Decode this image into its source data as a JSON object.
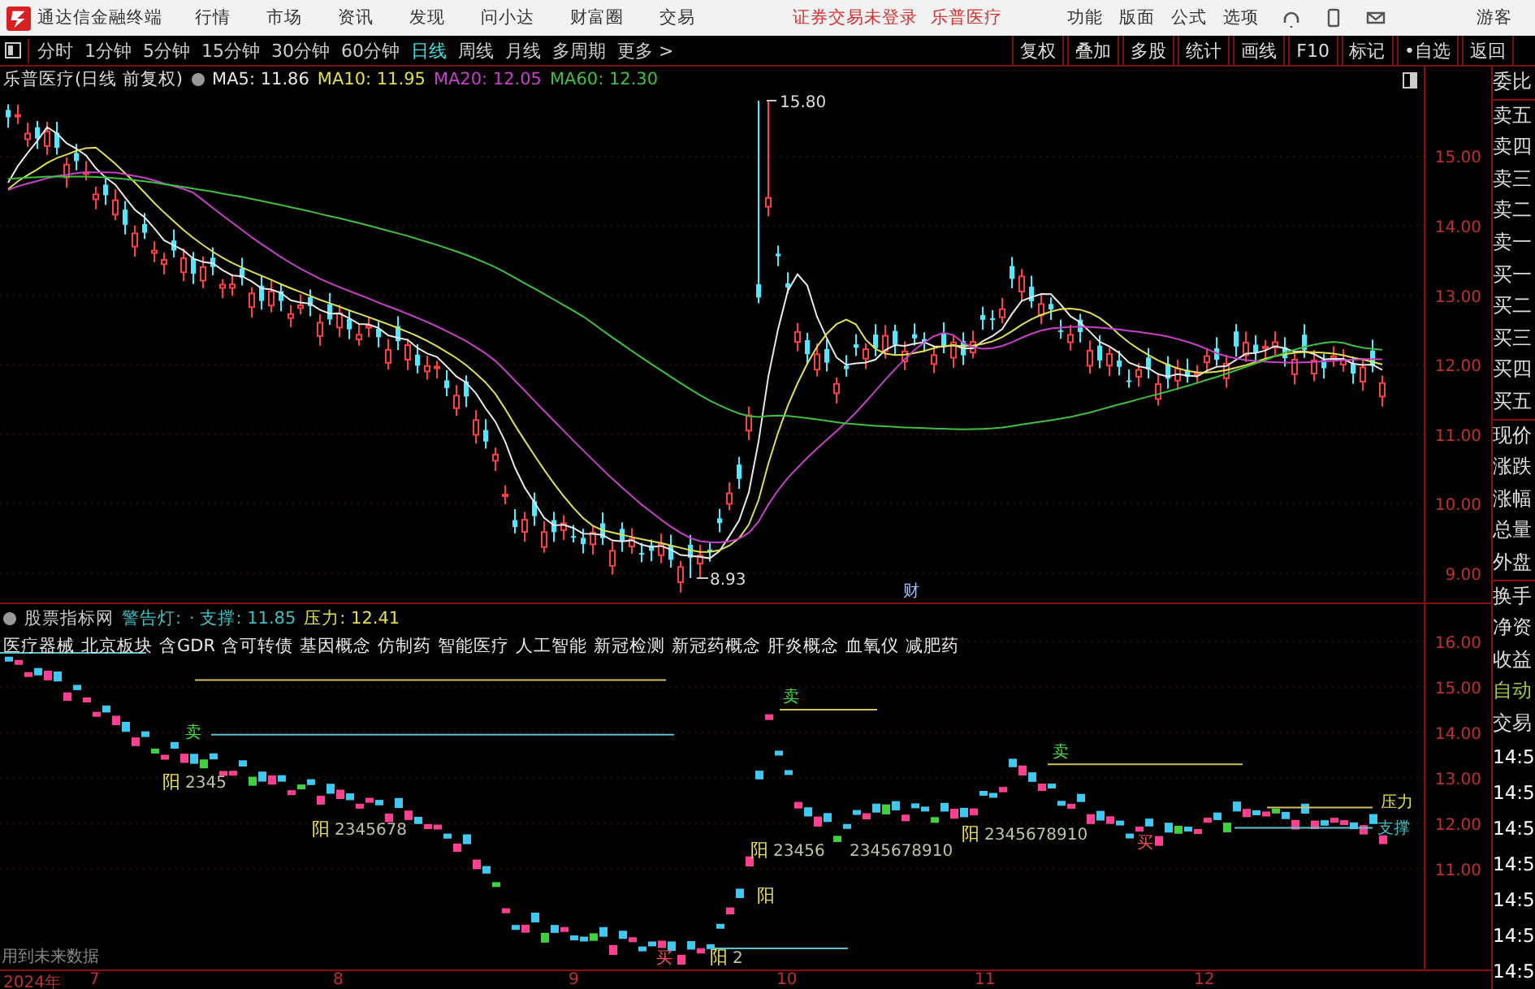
{
  "title_bar": {
    "app_name": "通达信金融终端",
    "menus": [
      "行情",
      "市场",
      "资讯",
      "发现",
      "问小达",
      "财富圈",
      "交易"
    ],
    "login_status": "证券交易未登录",
    "stock_link": "乐普医疗",
    "tools": [
      "功能",
      "版面",
      "公式",
      "选项"
    ],
    "user": "游客"
  },
  "toolbar": {
    "periods": [
      {
        "label": "分时",
        "selected": false
      },
      {
        "label": "1分钟",
        "selected": false
      },
      {
        "label": "5分钟",
        "selected": false
      },
      {
        "label": "15分钟",
        "selected": false
      },
      {
        "label": "30分钟",
        "selected": false
      },
      {
        "label": "60分钟",
        "selected": false
      },
      {
        "label": "日线",
        "selected": true
      },
      {
        "label": "周线",
        "selected": false
      },
      {
        "label": "月线",
        "selected": false
      },
      {
        "label": "多周期",
        "selected": false
      },
      {
        "label": "更多 >",
        "selected": false
      }
    ],
    "buttons": [
      "复权",
      "叠加",
      "多股",
      "统计",
      "画线",
      "F10",
      "标记",
      "•自选",
      "返回"
    ]
  },
  "price_chart": {
    "title": "乐普医疗(日线 前复权)",
    "ma": [
      {
        "label": "MA5: 11.86",
        "color": "#e8e8e8"
      },
      {
        "label": "MA10: 11.95",
        "color": "#e0e050"
      },
      {
        "label": "MA20: 12.05",
        "color": "#c840c8"
      },
      {
        "label": "MA60: 12.30",
        "color": "#40c040"
      }
    ],
    "y_ticks": [
      "15.00",
      "14.00",
      "13.00",
      "12.00",
      "11.00",
      "10.00",
      "9.00"
    ],
    "high_label": "15.80",
    "low_label": "8.93",
    "event_marker": "财"
  },
  "indicator": {
    "source": "股票指标网",
    "name": "警告灯:",
    "support": "· 支撑: 11.85",
    "pressure": "压力: 12.41",
    "concepts": [
      "医疗器械",
      "北京板块",
      "含GDR",
      "含可转债",
      "基因概念",
      "仿制药",
      "智能医疗",
      "人工智能",
      "新冠检测",
      "新冠药概念",
      "肝炎概念",
      "血氧仪",
      "减肥药"
    ],
    "y_ticks": [
      "16.00",
      "15.00",
      "14.00",
      "13.00",
      "12.00",
      "11.00"
    ],
    "signals": [
      {
        "kind": "yang",
        "label": "阳",
        "count": "2345"
      },
      {
        "kind": "yang",
        "label": "阳",
        "count": "2345678"
      },
      {
        "kind": "yang",
        "label": "阳",
        "count": "23456"
      },
      {
        "kind": "count",
        "count": "2345678910"
      },
      {
        "kind": "yang",
        "label": "阳",
        "count": "2345678910"
      },
      {
        "kind": "yang",
        "label": "阳"
      },
      {
        "kind": "yang",
        "label": "阳",
        "count": "2"
      },
      {
        "kind": "sell",
        "label": "卖"
      },
      {
        "kind": "sell",
        "label": "卖"
      },
      {
        "kind": "sell",
        "label": "卖"
      },
      {
        "kind": "buy",
        "label": "买"
      },
      {
        "kind": "buy",
        "label": "买"
      }
    ],
    "pressure_label": "压力",
    "support_label": "支撑",
    "notice": "用到未来数据"
  },
  "date_axis": [
    "2024年",
    "7",
    "8",
    "9",
    "10",
    "11",
    "12"
  ],
  "side_panel": {
    "fields": [
      "委比",
      "卖五",
      "卖四",
      "卖三",
      "卖二",
      "卖一",
      "买一",
      "买二",
      "买三",
      "买四",
      "买五",
      "现价",
      "涨跌",
      "涨幅",
      "总量",
      "外盘",
      "换手",
      "净资",
      "收益"
    ],
    "actions": [
      "自动",
      "交易"
    ],
    "times": [
      "14:5",
      "14:5",
      "14:5",
      "14:5",
      "14:5",
      "14:5",
      "14:5"
    ]
  }
}
